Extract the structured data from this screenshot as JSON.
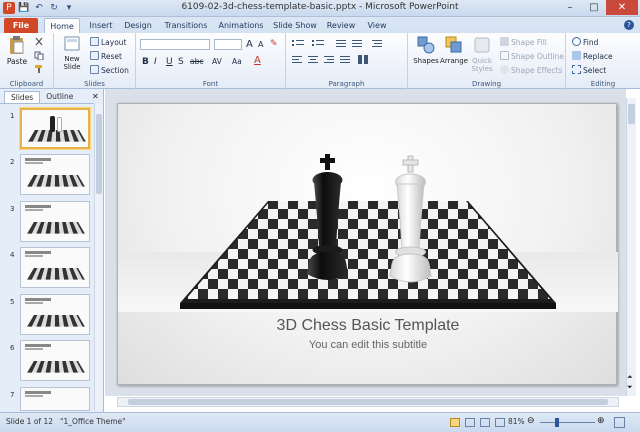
{
  "window": {
    "title": "6109-02-3d-chess-template-basic.pptx - Microsoft PowerPoint",
    "minimize": "–",
    "maximize": "□",
    "close": "✕"
  },
  "qat": {
    "save": "💾",
    "undo": "↶",
    "redo": "↻",
    "more": "▾"
  },
  "tabs": [
    "File",
    "Home",
    "Insert",
    "Design",
    "Transitions",
    "Animations",
    "Slide Show",
    "Review",
    "View"
  ],
  "ribbon": {
    "clipboard": {
      "paste": "Paste",
      "label": "Clipboard"
    },
    "slides": {
      "new_slide": "New Slide",
      "layout": "Layout",
      "reset": "Reset",
      "section": "Section",
      "label": "Slides"
    },
    "font": {
      "label": "Font",
      "bold": "B",
      "italic": "I",
      "underline": "U",
      "strike": "S",
      "abc": "abc",
      "spacing": "AV",
      "case": "Aa",
      "grow": "A",
      "shrink": "A"
    },
    "paragraph": {
      "label": "Paragraph"
    },
    "drawing": {
      "shapes": "Shapes",
      "arrange": "Arrange",
      "quick_styles": "Quick Styles",
      "shape_fill": "Shape Fill",
      "shape_outline": "Shape Outline",
      "shape_effects": "Shape Effects",
      "label": "Drawing"
    },
    "editing": {
      "find": "Find",
      "replace": "Replace",
      "select": "Select",
      "label": "Editing"
    }
  },
  "left_pane": {
    "tab_slides": "Slides",
    "tab_outline": "Outline",
    "close": "✕",
    "slide_numbers": [
      "1",
      "2",
      "3",
      "4",
      "5",
      "6",
      "7"
    ]
  },
  "slide": {
    "title": "3D Chess Basic Template",
    "subtitle": "You can edit this subtitle"
  },
  "status": {
    "slide_of": "Slide 1 of 12",
    "theme": "\"1_Office Theme\"",
    "zoom": "81%"
  },
  "colors": {
    "file_tab": "#d24726",
    "accent": "#2b579a"
  }
}
